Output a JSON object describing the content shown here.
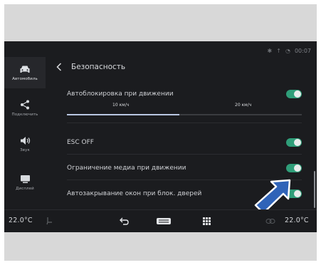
{
  "status": {
    "time": "00:07"
  },
  "sidebar": {
    "items": [
      {
        "label": "Автомобиль",
        "icon": "car-icon",
        "active": true
      },
      {
        "label": "Подключить",
        "icon": "share-icon",
        "active": false
      },
      {
        "label": "Звук",
        "icon": "speaker-icon",
        "active": false
      },
      {
        "label": "Дисплей",
        "icon": "display-icon",
        "active": false
      }
    ]
  },
  "header": {
    "title": "Безопасность",
    "back_icon": "chevron-left-icon"
  },
  "settings": {
    "autolock": {
      "label": "Автоблокировка при движении",
      "enabled": true
    },
    "speed_options": [
      "10 км/ч",
      "20 км/ч"
    ],
    "speed_selected": "10 км/ч",
    "esc": {
      "label": "ESC OFF",
      "enabled": true
    },
    "media": {
      "label": "Ограничение медиа при движении",
      "enabled": true
    },
    "windows": {
      "label": "Автозакрывание окон при блок. дверей",
      "enabled": true
    }
  },
  "bottombar": {
    "temp_left": "22.0°C",
    "temp_right": "22.0°C",
    "icons": [
      "seat-heat-icon",
      "back-arrow-icon",
      "climate-icon",
      "grid-menu-icon",
      "fan-icon"
    ]
  },
  "colors": {
    "toggle_on": "#2f9e79",
    "accent_arrow": "#2f63b8",
    "screen_bg": "#1b1c1f"
  }
}
